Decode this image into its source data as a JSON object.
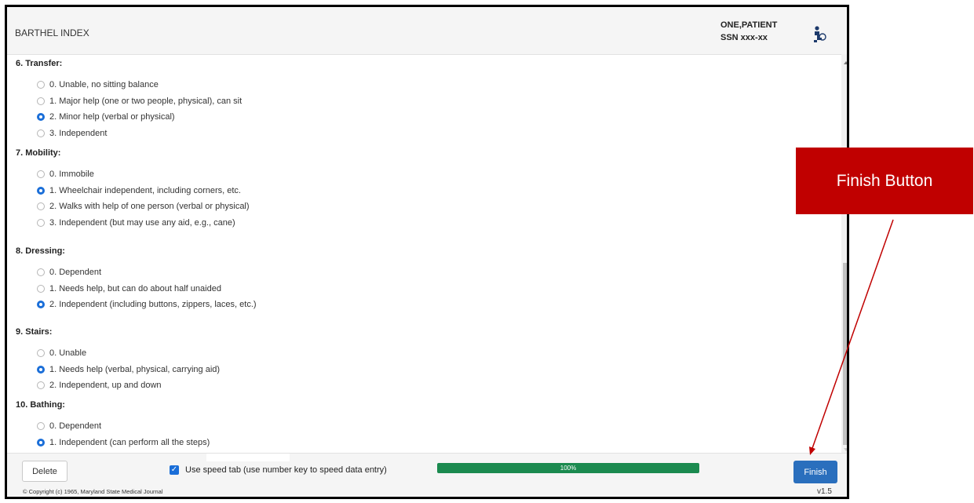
{
  "header": {
    "title": "BARTHEL INDEX",
    "patient_name": "ONE,PATIENT",
    "patient_ssn": "SSN xxx-xx",
    "user_icon": "user-icon"
  },
  "sections": [
    {
      "title": "6. Transfer:",
      "options": [
        {
          "label": "0. Unable, no sitting balance",
          "selected": false
        },
        {
          "label": "1. Major help (one or two people, physical), can sit",
          "selected": false
        },
        {
          "label": "2. Minor help (verbal or physical)",
          "selected": true
        },
        {
          "label": "3. Independent",
          "selected": false
        }
      ]
    },
    {
      "title": "7. Mobility:",
      "options": [
        {
          "label": "0. Immobile",
          "selected": false
        },
        {
          "label": "1. Wheelchair independent, including corners, etc.",
          "selected": true
        },
        {
          "label": "2. Walks with help of one person (verbal or physical)",
          "selected": false
        },
        {
          "label": "3. Independent (but may use any aid, e.g., cane)",
          "selected": false
        }
      ]
    },
    {
      "title": "8. Dressing:",
      "options": [
        {
          "label": "0. Dependent",
          "selected": false
        },
        {
          "label": "1. Needs help, but can do about half unaided",
          "selected": false
        },
        {
          "label": "2. Independent (including buttons, zippers, laces, etc.)",
          "selected": true
        }
      ]
    },
    {
      "title": "9. Stairs:",
      "options": [
        {
          "label": "0. Unable",
          "selected": false
        },
        {
          "label": "1. Needs help (verbal, physical, carrying aid)",
          "selected": true
        },
        {
          "label": "2. Independent, up and down",
          "selected": false
        }
      ]
    },
    {
      "title": "10. Bathing:",
      "options": [
        {
          "label": "0. Dependent",
          "selected": false
        },
        {
          "label": "1. Independent (can perform all the steps)",
          "selected": true
        }
      ]
    }
  ],
  "footer": {
    "delete_label": "Delete",
    "speed_tab_label": "Use speed tab (use number key to speed data entry)",
    "speed_tab_checked": true,
    "progress_text": "100%",
    "progress_value": 100,
    "finish_label": "Finish",
    "copyright": "© Copyright (c) 1965, Maryland State Medical Journal",
    "version": "v1.5"
  },
  "annotation": {
    "callout_text": "Finish Button",
    "callout_color": "#c00000"
  },
  "colors": {
    "accent": "#1a6ed8",
    "finish_button": "#2a6fbd",
    "progress_fill": "#1b8a4f"
  }
}
